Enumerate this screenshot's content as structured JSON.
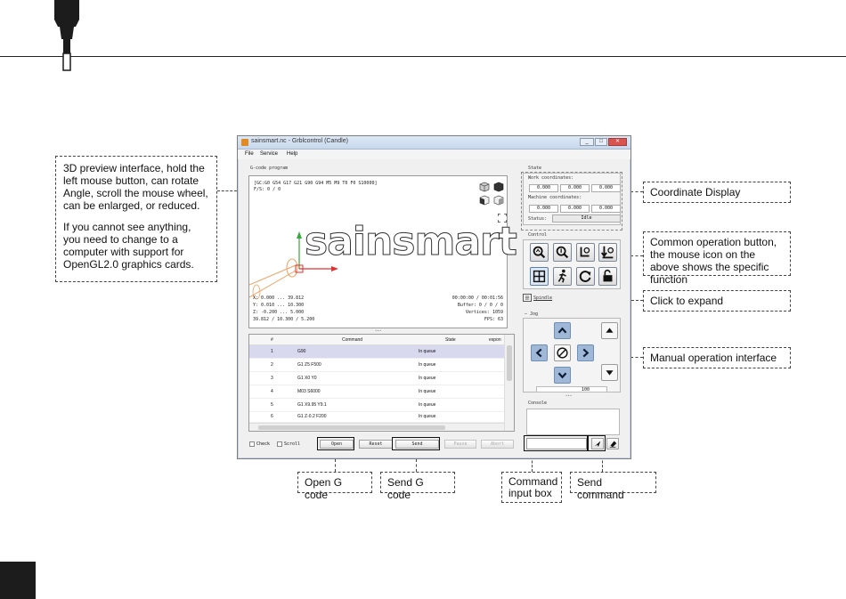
{
  "window": {
    "title": "sainsmart.nc - Grblcontrol (Candle)",
    "min_glyph": "_",
    "max_glyph": "□",
    "close_glyph": "✕"
  },
  "menu": [
    "File",
    "Service",
    "Help"
  ],
  "gcode_group_label": "G-code program",
  "viewport": {
    "parser_state": "[GC:G0 G54 G17 G21 G90 G94 M5 M9 T0 F0 S10000]",
    "feed_spindle": "F/S: 0 / 0",
    "logo_text": "sainsmart",
    "x_line": "X: 0.000 ... 39.812",
    "y_line": "Y: 0.010 ... 10.300",
    "z_line": "Z: -0.200 ... 5.000",
    "size_line": "39.812 / 10.300 / 5.200",
    "time_line": "00:00:00 / 00:01:56",
    "buffer_line": "Buffer: 0 / 0 / 0",
    "vertices_line": "Vertices: 1059",
    "fps_line": "FPS: 63"
  },
  "table": {
    "headers": [
      "#",
      "Command",
      "State",
      "espon"
    ],
    "rows": [
      {
        "num": "1",
        "command": "G90",
        "state": "In queue"
      },
      {
        "num": "2",
        "command": "G1 Z5 F500",
        "state": "In queue"
      },
      {
        "num": "3",
        "command": "G1 X0 Y0",
        "state": "In queue"
      },
      {
        "num": "4",
        "command": "M03 S6000",
        "state": "In queue"
      },
      {
        "num": "5",
        "command": "G1 X9.95 Y9.1",
        "state": "In queue"
      },
      {
        "num": "6",
        "command": "G1 Z-0.2 F200",
        "state": "In queue"
      }
    ]
  },
  "bottom_bar": {
    "check_label": "Check",
    "scroll_label": "Scroll",
    "open": "Open",
    "reset": "Reset",
    "send": "Send",
    "pause": "Pause",
    "abort": "Abort"
  },
  "state_panel": {
    "label": "State",
    "work_label": "Work coordinates:",
    "work": [
      "0.000",
      "0.000",
      "0.000"
    ],
    "machine_label": "Machine coordinates:",
    "machine": [
      "0.000",
      "0.000",
      "0.000"
    ],
    "status_label": "Status:",
    "status_value": "Idle"
  },
  "control_label": "Control",
  "spindle_label": "Spindle",
  "jog_label": "Jog",
  "jog_step_value": "100",
  "console_label": "Console",
  "callouts": {
    "preview_p1": "3D preview interface, hold the left mouse button, can rotate Angle, scroll the mouse wheel, can be enlarged, or reduced.",
    "preview_p2": "If you cannot see anything, you need to change to a computer with support for OpenGL2.0 graphics cards.",
    "coordinate": "Coordinate Display",
    "common": "Common operation button, the mouse icon on the above shows the specific function",
    "expand": "Click to expand",
    "manual": "Manual operation interface",
    "open_g": "Open G code",
    "send_g": "Send G code",
    "cmd_input": "Command input box",
    "send_cmd": "Send command"
  }
}
